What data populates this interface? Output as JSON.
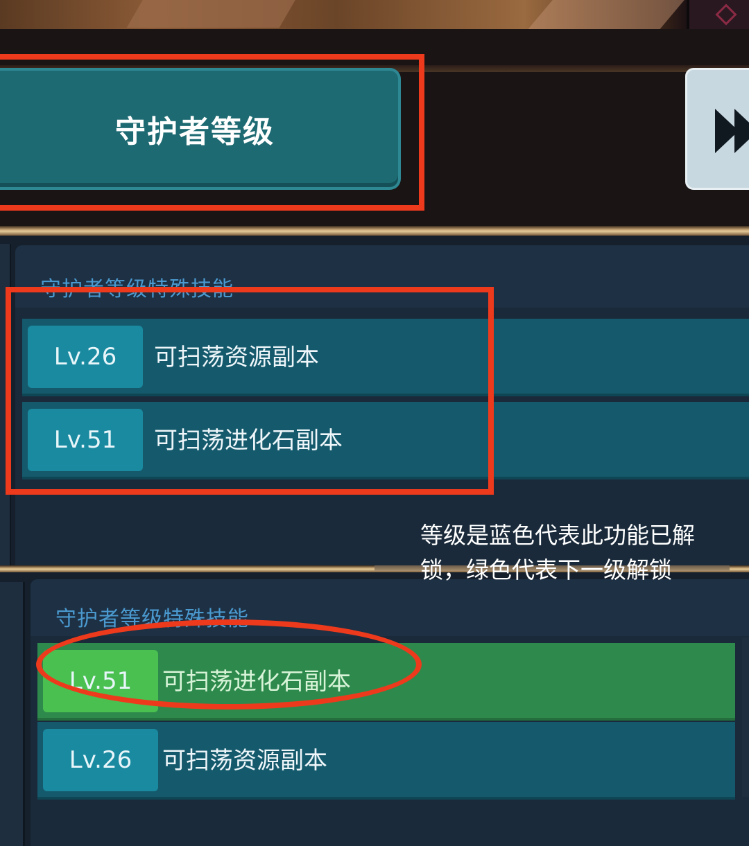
{
  "header": {
    "guardian_level_button": "守护者等级"
  },
  "panel_top": {
    "title": "守护者等级特殊技能",
    "rows": [
      {
        "level": "Lv.26",
        "text": "可扫荡资源副本",
        "state": "unlocked"
      },
      {
        "level": "Lv.51",
        "text": "可扫荡进化石副本",
        "state": "unlocked"
      }
    ]
  },
  "panel_bottom": {
    "title": "守护者等级特殊技能",
    "rows": [
      {
        "level": "Lv.51",
        "text": "可扫荡进化石副本",
        "state": "next"
      },
      {
        "level": "Lv.26",
        "text": "可扫荡资源副本",
        "state": "unlocked"
      }
    ]
  },
  "annotation": {
    "note": "等级是蓝色代表此功能已解锁，绿色代表下一级解锁",
    "color": "#ee3a1c"
  },
  "colors": {
    "unlocked": "#1a8aa0",
    "next": "#4ac050"
  },
  "icons": {
    "skip": "fast-forward-icon"
  }
}
